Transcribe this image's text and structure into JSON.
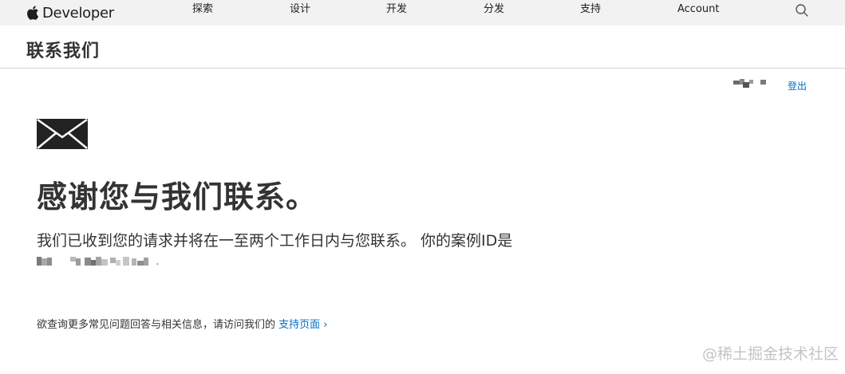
{
  "globalnav": {
    "brand_label": "Developer",
    "items": [
      "探索",
      "设计",
      "开发",
      "分发",
      "支持",
      "Account"
    ]
  },
  "localnav": {
    "title": "联系我们"
  },
  "account": {
    "signout_label": "登出"
  },
  "main": {
    "heading": "感谢您与我们联系。",
    "message": "我们已收到您的请求并将在一至两个工作日内与您联系。 你的案例ID是",
    "case_id_suffix": ".",
    "support_prefix": "欲查询更多常见问题回答与相关信息，请访问我们的 ",
    "support_link_label": "支持页面 ›"
  },
  "watermark": "@稀土掘金技术社区",
  "colors": {
    "accent": "#0070c9",
    "nav_bg": "#f2f2f2",
    "text": "#333333"
  }
}
